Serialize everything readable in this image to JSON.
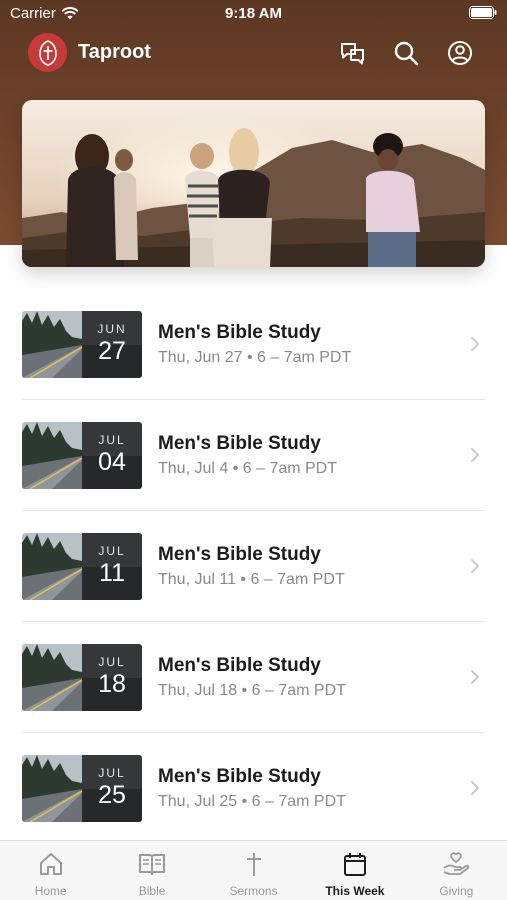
{
  "status_bar": {
    "carrier": "Carrier",
    "time": "9:18 AM"
  },
  "app_bar": {
    "title": "Taproot"
  },
  "events": [
    {
      "title": "Men's Bible Study",
      "month": "JUN",
      "day": "27",
      "time": "Thu, Jun 27 • 6 – 7am PDT"
    },
    {
      "title": "Men's Bible Study",
      "month": "JUL",
      "day": "04",
      "time": "Thu, Jul 4 • 6 – 7am PDT"
    },
    {
      "title": "Men's Bible Study",
      "month": "JUL",
      "day": "11",
      "time": "Thu, Jul 11 • 6 – 7am PDT"
    },
    {
      "title": "Men's Bible Study",
      "month": "JUL",
      "day": "18",
      "time": "Thu, Jul 18 • 6 – 7am PDT"
    },
    {
      "title": "Men's Bible Study",
      "month": "JUL",
      "day": "25",
      "time": "Thu, Jul 25 • 6 – 7am PDT"
    }
  ],
  "tab_bar": {
    "items": [
      {
        "label": "Home",
        "icon": "home-icon"
      },
      {
        "label": "Bible",
        "icon": "book-icon"
      },
      {
        "label": "Sermons",
        "icon": "cross-icon"
      },
      {
        "label": "This Week",
        "icon": "calendar-icon",
        "active": true
      },
      {
        "label": "Giving",
        "icon": "giving-hand-icon"
      }
    ]
  },
  "colors": {
    "header_brown": "#6b412a",
    "logo_red": "#c73a3a",
    "active_tab": "#1c1c1e",
    "inactive_tab": "#9a9a9a"
  }
}
